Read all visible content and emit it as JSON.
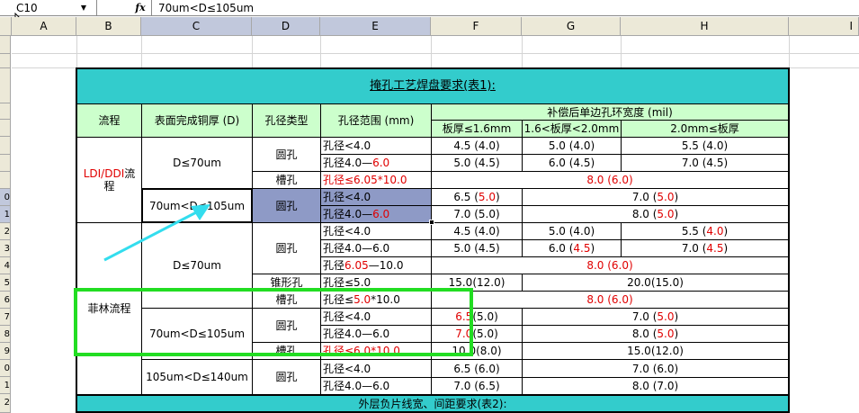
{
  "formula_bar": {
    "cell_ref": "C10",
    "fx_label": "fx",
    "content": "70um<D≤105um"
  },
  "columns": [
    "A",
    "B",
    "C",
    "D",
    "E",
    "F",
    "G",
    "H",
    "I"
  ],
  "rows": [
    "",
    "",
    "",
    "",
    "",
    "",
    "",
    "",
    "",
    "0",
    "1",
    "2",
    "3",
    "3",
    "4",
    "5",
    "6",
    "7",
    "8",
    "9",
    "0",
    "1",
    "2"
  ],
  "table": {
    "title": "掩孔工艺焊盘要求(表1):",
    "h_process": "流程",
    "h_copper": "表面完成铜厚 (D)",
    "h_hole_type": "孔径类型",
    "h_hole_range": "孔径范围 (mm)",
    "h_compensation": "补偿后单边孔环宽度 (mil)",
    "h_thick1": "板厚≤1.6mm",
    "h_thick2": "1.6<板厚<2.0mm",
    "h_thick3": "2.0mm≤板厚",
    "ldi_red": "LDI/DDI",
    "ldi_black1": "流",
    "ldi_black2": "程",
    "felin": "菲林流程",
    "d70": "D≤70um",
    "d70b": "D≤70um",
    "d105": "70um<D≤105um",
    "d105b": "70um<D≤105um",
    "d140": "105um<D≤140um",
    "round": "圆孔",
    "slot": "槽孔",
    "taper": "锥形孔",
    "r1": {
      "e": "孔径<4.0",
      "f": "4.5 (4.0)",
      "g": "5.0 (4.0)",
      "h": "5.5 (4.0)"
    },
    "r2": {
      "e1": "孔径4.0—",
      "e2": "6.0",
      "f": "5.0 (4.5)",
      "g": "6.0 (4.5)",
      "h": "7.0 (4.5)"
    },
    "r3": {
      "e": "孔径≤6.05*10.0",
      "fgh": "8.0 (6.0)"
    },
    "r4": {
      "e": "孔径<4.0",
      "f1": "6.5 (",
      "f2": "5.0",
      ")": ")",
      "gh1": "7.0 (",
      "gh2": "5.0"
    },
    "r5": {
      "e1": "孔径4.0—",
      "e2": "6.0",
      "f": "7.0 (5.0)",
      "gh1": "8.0 (",
      "gh2": "5.0"
    },
    "r6": {
      "e": "孔径<4.0",
      "f": "4.5 (4.0)",
      "g": "5.0 (4.0)",
      "h1": "5.5 (",
      "h2": "4.0"
    },
    "r7": {
      "e": "孔径4.0—6.0",
      "f": "5.0 (4.5)",
      "g1": "6.0 (",
      "g2": "4.5",
      "h1": "7.0 (",
      "h2": "4.5"
    },
    "r8": {
      "e1": "孔径",
      "e2": "6.05",
      "e3": "—10.0",
      "fgh": "8.0 (6.0)"
    },
    "r9": {
      "e": "孔径≤5.0",
      "f": "15.0(12.0)",
      "gh": "20.0(15.0)"
    },
    "r10": {
      "e1": "孔径≤",
      "e2": "5.0",
      "e3": "*10.0",
      "fgh": "8.0 (6.0)"
    },
    "r11": {
      "e": "孔径<4.0",
      "f1": "6.5",
      "f2": "(5.0)",
      "gh1": "7.0 (",
      "gh2": "5.0"
    },
    "r12": {
      "e": "孔径4.0—6.0",
      "f1": "7.0",
      "f2": "(5.0)",
      "gh1": "8.0 (",
      "gh2": "5.0"
    },
    "r13": {
      "e": "孔径≤6.0*10.0",
      "f": "10.0(8.0)",
      "gh": "15.0(12.0)"
    },
    "r14": {
      "e": "孔径<4.0",
      "f": "6.5 (6.0)",
      "gh": "7.0 (6.0)"
    },
    "r15": {
      "e": "孔径4.0—6.0",
      "f": "7.0 (6.5)",
      "gh": "8.0 (7.0)"
    },
    "footer": "外层负片线宽、间距要求(表2):"
  },
  "colors": {
    "teal": "#33cccc",
    "green_header": "#ccffcc",
    "red_text": "#e00000",
    "highlight_box": "#22dd22",
    "arrow": "#33ddee"
  }
}
